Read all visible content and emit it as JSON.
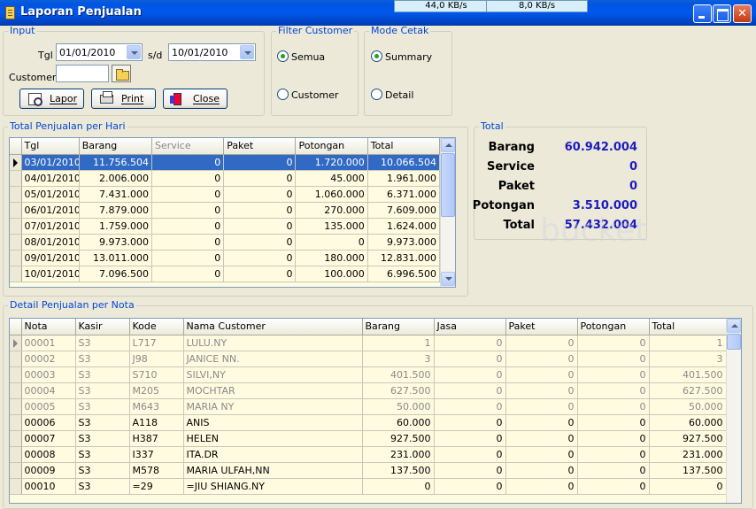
{
  "window": {
    "title": "Laporan Penjualan"
  },
  "speeds": [
    "44,0 KB/s",
    "8,0 KB/s"
  ],
  "input": {
    "legend": "Input",
    "tgl_label": "Tgl",
    "from_date": "01/01/2010",
    "sd_label": "s/d",
    "to_date": "10/01/2010",
    "customer_label": "Customer",
    "customer_value": "",
    "lapor_label": "Lapor",
    "print_label": "Print",
    "close_label": "Close"
  },
  "filter_customer": {
    "legend": "Filter Customer",
    "semua": "Semua",
    "customer": "Customer",
    "selected": "Semua"
  },
  "mode_cetak": {
    "legend": "Mode Cetak",
    "summary": "Summary",
    "detail": "Detail",
    "selected": "Summary"
  },
  "daily": {
    "legend": "Total Penjualan per Hari",
    "columns": [
      "Tgl",
      "Barang",
      "Service",
      "Paket",
      "Potongan",
      "Total"
    ],
    "rows": [
      [
        "03/01/2010",
        "11.756.504",
        "0",
        "0",
        "1.720.000",
        "10.066.504"
      ],
      [
        "04/01/2010",
        "2.006.000",
        "0",
        "0",
        "45.000",
        "1.961.000"
      ],
      [
        "05/01/2010",
        "7.431.000",
        "0",
        "0",
        "1.060.000",
        "6.371.000"
      ],
      [
        "06/01/2010",
        "7.879.000",
        "0",
        "0",
        "270.000",
        "7.609.000"
      ],
      [
        "07/01/2010",
        "1.759.000",
        "0",
        "0",
        "135.000",
        "1.624.000"
      ],
      [
        "08/01/2010",
        "9.973.000",
        "0",
        "0",
        "0",
        "9.973.000"
      ],
      [
        "09/01/2010",
        "13.011.000",
        "0",
        "0",
        "180.000",
        "12.831.000"
      ],
      [
        "10/01/2010",
        "7.096.500",
        "0",
        "0",
        "100.000",
        "6.996.500"
      ]
    ]
  },
  "totals": {
    "legend": "Total",
    "items": [
      {
        "label": "Barang",
        "value": "60.942.004"
      },
      {
        "label": "Service",
        "value": "0"
      },
      {
        "label": "Paket",
        "value": "0"
      },
      {
        "label": "Potongan",
        "value": "3.510.000"
      },
      {
        "label": "Total",
        "value": "57.432.004"
      }
    ]
  },
  "detail": {
    "legend": "Detail Penjualan per Nota",
    "columns": [
      "Nota",
      "Kasir",
      "Kode",
      "Nama Customer",
      "Barang",
      "Jasa",
      "Paket",
      "Potongan",
      "Total"
    ],
    "rows": [
      [
        "00001",
        "S3",
        "L717",
        "LULU.NY",
        "1",
        "0",
        "0",
        "0",
        "1"
      ],
      [
        "00002",
        "S3",
        "J98",
        "JANICE NN.",
        "3",
        "0",
        "0",
        "0",
        "3"
      ],
      [
        "00003",
        "S3",
        "S710",
        "SILVI,NY",
        "401.500",
        "0",
        "0",
        "0",
        "401.500"
      ],
      [
        "00004",
        "S3",
        "M205",
        "MOCHTAR",
        "627.500",
        "0",
        "0",
        "0",
        "627.500"
      ],
      [
        "00005",
        "S3",
        "M643",
        "MARIA NY",
        "50.000",
        "0",
        "0",
        "0",
        "50.000"
      ],
      [
        "00006",
        "S3",
        "A118",
        "ANIS",
        "60.000",
        "0",
        "0",
        "0",
        "60.000"
      ],
      [
        "00007",
        "S3",
        "H387",
        "HELEN",
        "927.500",
        "0",
        "0",
        "0",
        "927.500"
      ],
      [
        "00008",
        "S3",
        "I337",
        "ITA.DR",
        "231.000",
        "0",
        "0",
        "0",
        "231.000"
      ],
      [
        "00009",
        "S3",
        "M578",
        "MARIA ULFAH,NN",
        "137.500",
        "0",
        "0",
        "0",
        "137.500"
      ],
      [
        "00010",
        "S3",
        "=29",
        "=JIU SHIANG.NY",
        "0",
        "0",
        "0",
        "0",
        "0"
      ]
    ]
  },
  "colors": {
    "accent": "#316ac5",
    "legend": "#0046d5",
    "total_value": "#1c1cbf",
    "grid_bg": "#fffbe1"
  }
}
